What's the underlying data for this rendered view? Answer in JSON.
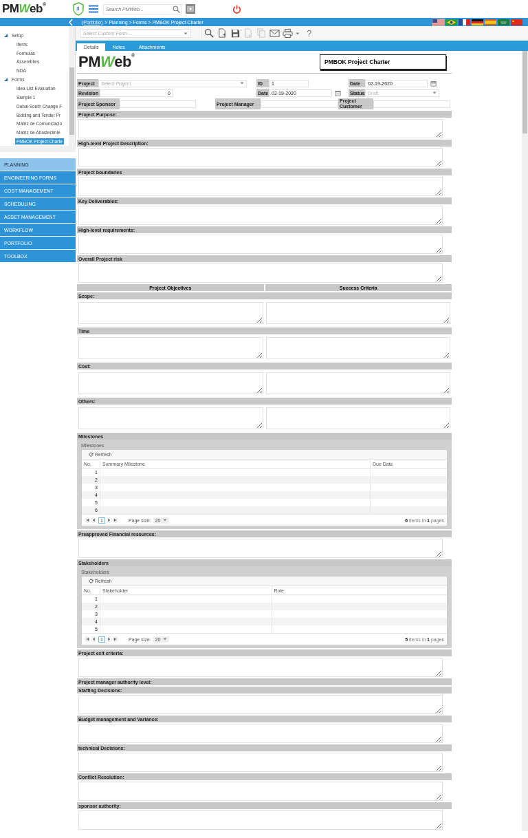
{
  "header": {
    "logo": [
      {
        "text": "PM",
        "accent": false
      },
      {
        "text": "W",
        "accent": true
      },
      {
        "text": "eb",
        "accent": false
      }
    ],
    "logo_mark": "®",
    "badge": "3",
    "search_placeholder": "Search PMWeb..."
  },
  "breadcrumb": [
    {
      "text": "(Portfolio)",
      "link": true
    },
    {
      "text": "> Planning > Forms > PMBOK Project Charter",
      "link": false
    }
  ],
  "flags": [
    {
      "kind": "us",
      "selected": true
    },
    {
      "kind": "br",
      "selected": false
    },
    {
      "kind": "fr",
      "selected": false
    },
    {
      "kind": "de",
      "selected": false
    },
    {
      "kind": "es",
      "selected": false
    },
    {
      "kind": "sa",
      "selected": false
    },
    {
      "kind": "cn",
      "selected": false
    }
  ],
  "tree": [
    {
      "label": "Setup",
      "expanded": true,
      "children": [
        {
          "label": "Items",
          "selected": false
        },
        {
          "label": "Formulas",
          "selected": false
        },
        {
          "label": "Assemblies",
          "selected": false
        },
        {
          "label": "NDA",
          "selected": false
        }
      ]
    },
    {
      "label": "Forms",
      "expanded": true,
      "children": [
        {
          "label": "Idea List Evaluation",
          "selected": false
        },
        {
          "label": "Sample 1",
          "selected": false
        },
        {
          "label": "Dubai South Change F",
          "selected": false
        },
        {
          "label": "Bidding and Tender Pr",
          "selected": false
        },
        {
          "label": "Matriz de Comunicacio",
          "selected": false
        },
        {
          "label": "Matriz de Abastecimie",
          "selected": false
        },
        {
          "label": "PMBOK Project Charte",
          "selected": true
        }
      ]
    }
  ],
  "nav": [
    {
      "label": "PLANNING",
      "selected": true
    },
    {
      "label": "ENGINEERING FORMS",
      "selected": false
    },
    {
      "label": "COST MANAGEMENT",
      "selected": false
    },
    {
      "label": "SCHEDULING",
      "selected": false
    },
    {
      "label": "ASSET MANAGEMENT",
      "selected": false
    },
    {
      "label": "WORKFLOW",
      "selected": false
    },
    {
      "label": "PORTFOLIO",
      "selected": false
    },
    {
      "label": "TOOLBOX",
      "selected": false
    }
  ],
  "toolbar": {
    "form_placeholder": "Select Custom Form ...",
    "buttons": [
      {
        "kind": "search",
        "disabled": false
      },
      {
        "kind": "new",
        "disabled": false
      },
      {
        "kind": "save",
        "disabled": false
      },
      {
        "kind": "delete",
        "disabled": true
      },
      {
        "kind": "copy",
        "disabled": true
      },
      {
        "kind": "email",
        "disabled": false
      },
      {
        "kind": "print",
        "disabled": false
      }
    ],
    "help": "?"
  },
  "tabs": [
    {
      "label": "Details",
      "selected": true
    },
    {
      "label": "Notes",
      "selected": false
    },
    {
      "label": "Attachments",
      "selected": false
    }
  ],
  "form": {
    "logo": [
      {
        "text": "PM",
        "accent": false
      },
      {
        "text": "W",
        "accent": true
      },
      {
        "text": "eb",
        "accent": false
      }
    ],
    "logo_mark": "®",
    "title": "PMBOK Project Charter",
    "project": {
      "label": "Project",
      "placeholder": "Select Project."
    },
    "id": {
      "label": "ID",
      "value": "1"
    },
    "date_top": {
      "label": "Date",
      "value": "02-19-2020"
    },
    "revision": {
      "label": "Revision",
      "value": "0"
    },
    "date": {
      "label": "Date",
      "value": "02-19-2020"
    },
    "status": {
      "label": "Status",
      "value": "Draft",
      "disabled": true
    },
    "sponsor": {
      "label": "Project Sponsor"
    },
    "manager": {
      "label": "Project Manager"
    },
    "customer": {
      "label": "Project Customer"
    },
    "sections": [
      {
        "kind": "text",
        "label": "Project Purpose:"
      },
      {
        "kind": "text",
        "label": "High-level Project Description:"
      },
      {
        "kind": "text",
        "label": "Project boundaries"
      },
      {
        "kind": "text",
        "label": "Key Deliverables:"
      },
      {
        "kind": "text",
        "label": "High-level requirements:"
      },
      {
        "kind": "text",
        "label": "Overall Project risk"
      },
      {
        "kind": "columns",
        "labels": [
          "Project Objectives",
          "Success Criteria"
        ]
      },
      {
        "kind": "pair",
        "label": "Scope:"
      },
      {
        "kind": "pair",
        "label": "Time"
      },
      {
        "kind": "pair",
        "label": "Cost:"
      },
      {
        "kind": "pair",
        "label": "Others:"
      },
      {
        "kind": "grid",
        "label": "Milestones",
        "caption": "Milestones",
        "refresh": "Refresh",
        "columns": [
          "No.",
          "Summary Milestone",
          "Due Date"
        ],
        "rows": [
          "1",
          "2",
          "3",
          "4",
          "5",
          "6"
        ],
        "page": "1",
        "page_size_label": "Page size:",
        "page_size": "20",
        "summary": "**6** items in **1** pages"
      },
      {
        "kind": "text",
        "label": "Preapproved Financial resources:"
      },
      {
        "kind": "grid",
        "label": "Stakeholders",
        "caption": "Stakeholders",
        "refresh": "Refresh",
        "columns": [
          "No.",
          "Stakeholder",
          "Role"
        ],
        "rows": [
          "1",
          "2",
          "3",
          "4",
          "5"
        ],
        "page": "1",
        "page_size_label": "Page size:",
        "page_size": "20",
        "summary": "**5** items in **1** pages"
      },
      {
        "kind": "text",
        "label": "Project exit criteria:"
      },
      {
        "kind": "heading",
        "label": "Project manager authority level:"
      },
      {
        "kind": "text",
        "label": "Staffing Decisions:"
      },
      {
        "kind": "text",
        "label": "Budget management and Variance:"
      },
      {
        "kind": "text",
        "label": "technical Decisions:"
      },
      {
        "kind": "text",
        "label": "Conflict Resolution:"
      },
      {
        "kind": "text",
        "label": "sponsor authority:"
      }
    ]
  }
}
